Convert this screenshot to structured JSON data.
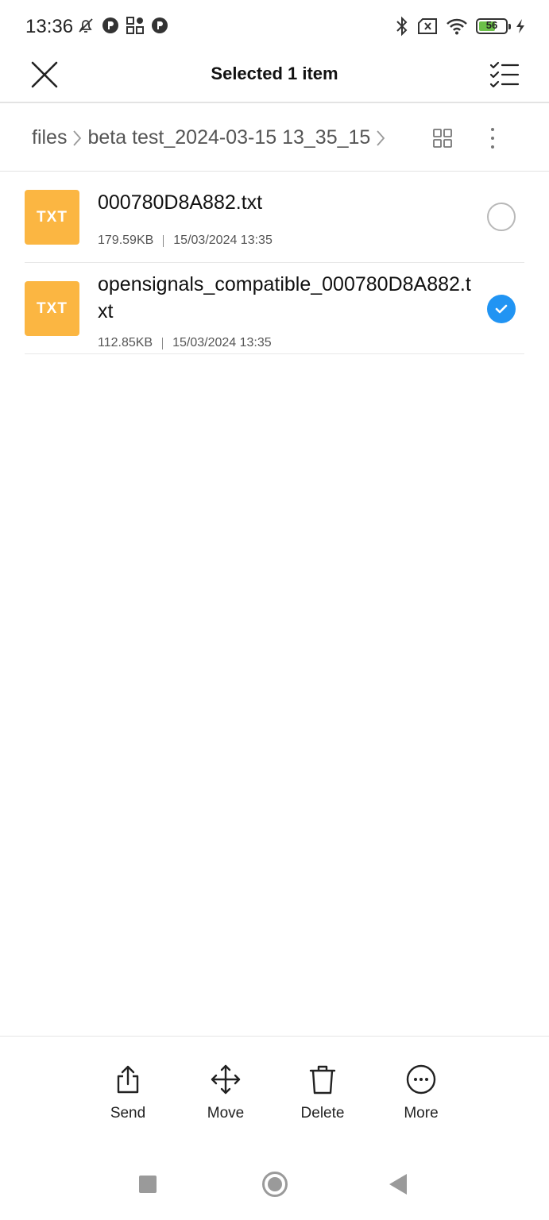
{
  "status_bar": {
    "time": "13:36",
    "battery_level": "56",
    "battery_color": "#6cc04a"
  },
  "header": {
    "title": "Selected 1 item",
    "close_icon": "close-icon",
    "select_all_icon": "select-all-checklist-icon"
  },
  "breadcrumb": {
    "items": [
      "files",
      "beta test_2024-03-15 13_35_15"
    ],
    "grid_view_icon": "grid-view-icon",
    "more_icon": "more-vertical-icon"
  },
  "files": [
    {
      "icon_label": "TXT",
      "name": "000780D8A882.txt",
      "size": "179.59KB",
      "date": "15/03/2024 13:35",
      "selected": false
    },
    {
      "icon_label": "TXT",
      "name": "opensignals_compatible_000780D8A882.txt",
      "size": "112.85KB",
      "date": "15/03/2024 13:35",
      "selected": true
    }
  ],
  "actions": [
    {
      "label": "Send",
      "icon": "share-icon"
    },
    {
      "label": "Move",
      "icon": "move-icon"
    },
    {
      "label": "Delete",
      "icon": "trash-icon"
    },
    {
      "label": "More",
      "icon": "more-horizontal-icon"
    }
  ],
  "colors": {
    "accent": "#2194f3",
    "file_icon": "#fbb642"
  }
}
